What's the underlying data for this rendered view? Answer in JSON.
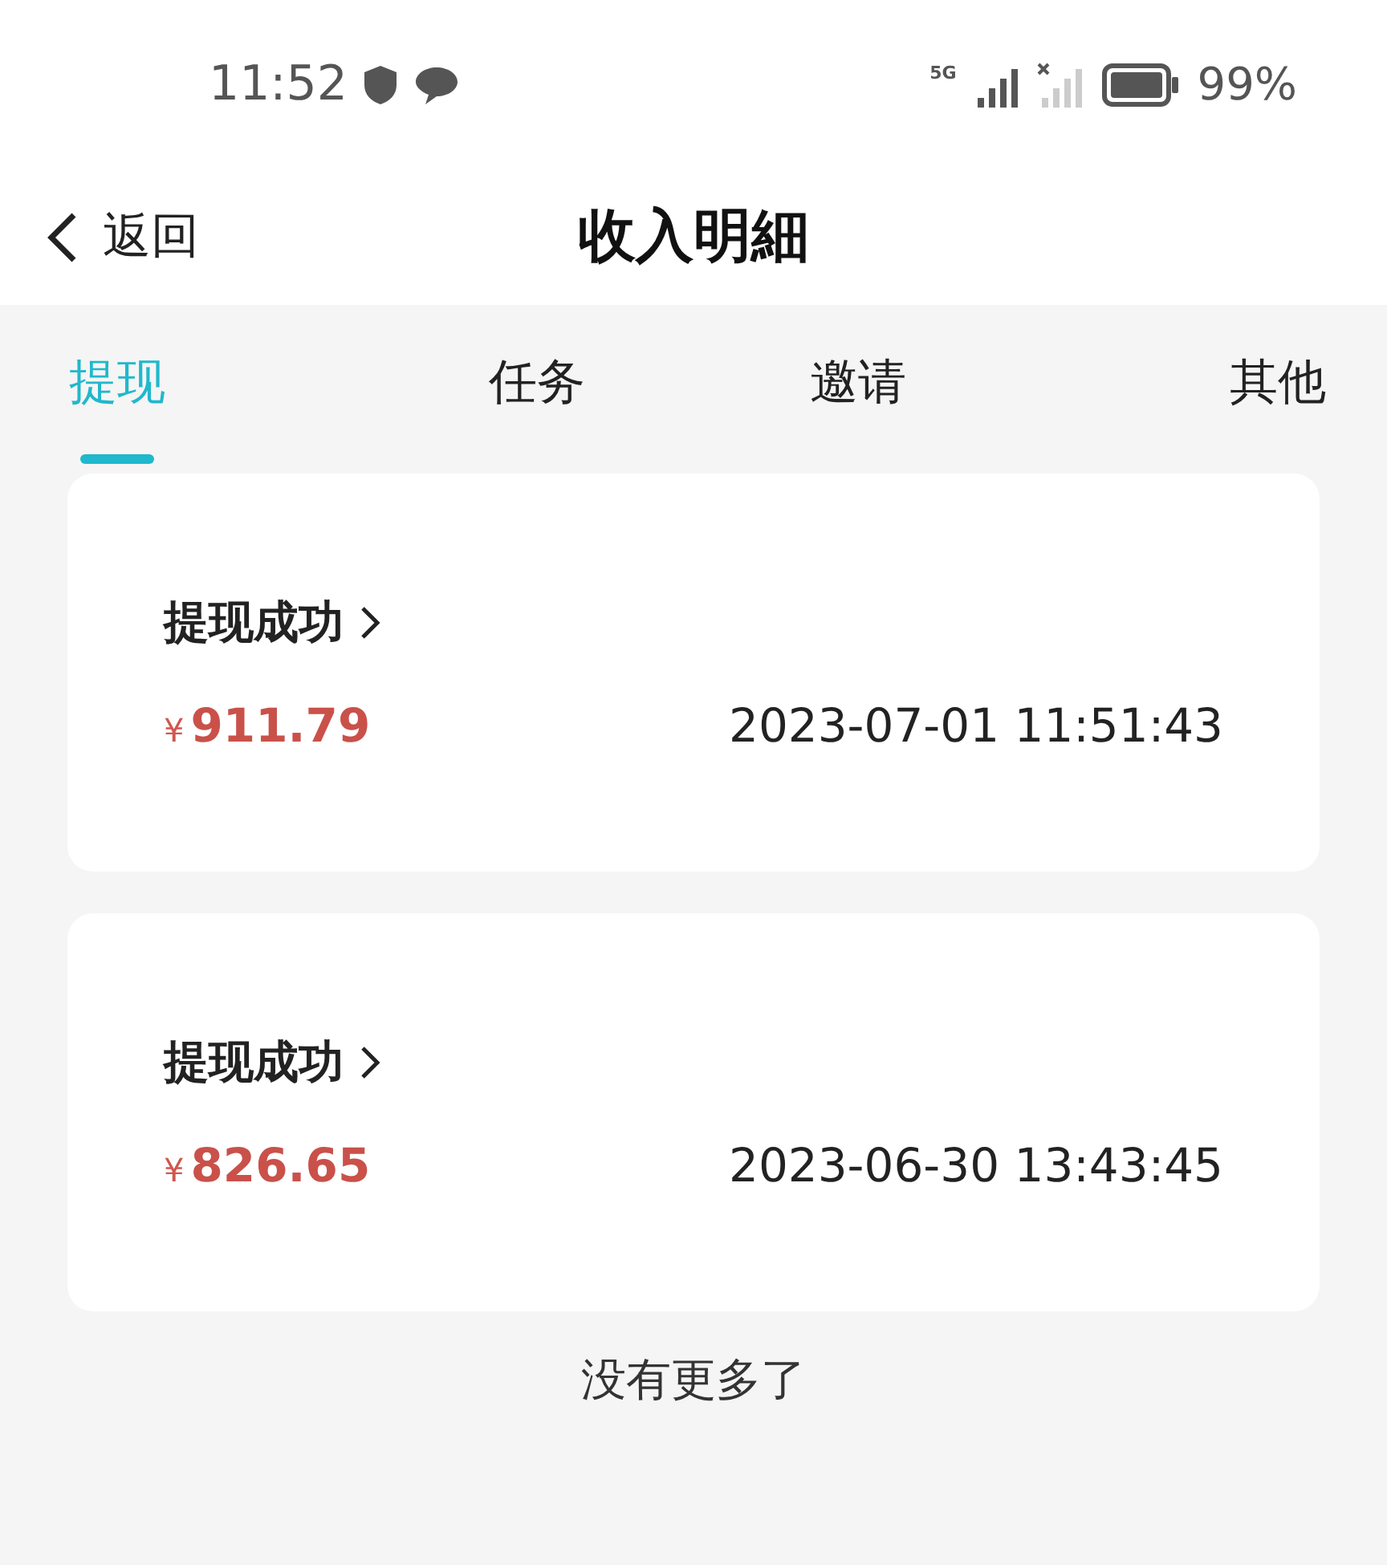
{
  "status_bar": {
    "time": "11:52",
    "network": "5G",
    "battery": "99%"
  },
  "header": {
    "back": "返回",
    "title": "收入明細"
  },
  "tabs": [
    {
      "label": "提现",
      "selected": true
    },
    {
      "label": "任务",
      "selected": false
    },
    {
      "label": "邀请",
      "selected": false
    },
    {
      "label": "其他",
      "selected": false
    }
  ],
  "records": [
    {
      "status": "提现成功",
      "currency": "¥",
      "amount": "911.79",
      "time": "2023-07-01 11:51:43"
    },
    {
      "status": "提现成功",
      "currency": "¥",
      "amount": "826.65",
      "time": "2023-06-30 13:43:45"
    }
  ],
  "footer": "没有更多了"
}
